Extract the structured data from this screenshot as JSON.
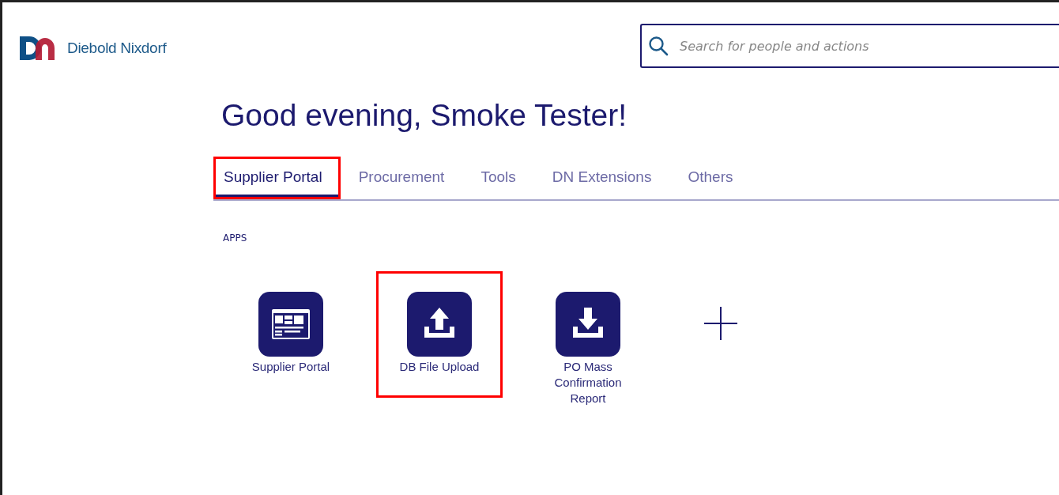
{
  "header": {
    "brand": "Diebold Nixdorf",
    "search": {
      "placeholder": "Search for people and actions"
    }
  },
  "greeting": "Good evening, Smoke Tester!",
  "tabs": [
    {
      "label": "Supplier Portal",
      "selected": true,
      "highlighted": true
    },
    {
      "label": "Procurement",
      "selected": false,
      "highlighted": false
    },
    {
      "label": "Tools",
      "selected": false,
      "highlighted": false
    },
    {
      "label": "DN Extensions",
      "selected": false,
      "highlighted": false
    },
    {
      "label": "Others",
      "selected": false,
      "highlighted": false
    }
  ],
  "section_title": "APPS",
  "apps": [
    {
      "kind": "dashboard",
      "label": "Supplier Portal",
      "highlighted": false
    },
    {
      "kind": "upload",
      "label": "DB File Upload",
      "highlighted": true
    },
    {
      "kind": "download",
      "label": "PO Mass Confirmation Report",
      "highlighted": false
    },
    {
      "kind": "add"
    }
  ]
}
